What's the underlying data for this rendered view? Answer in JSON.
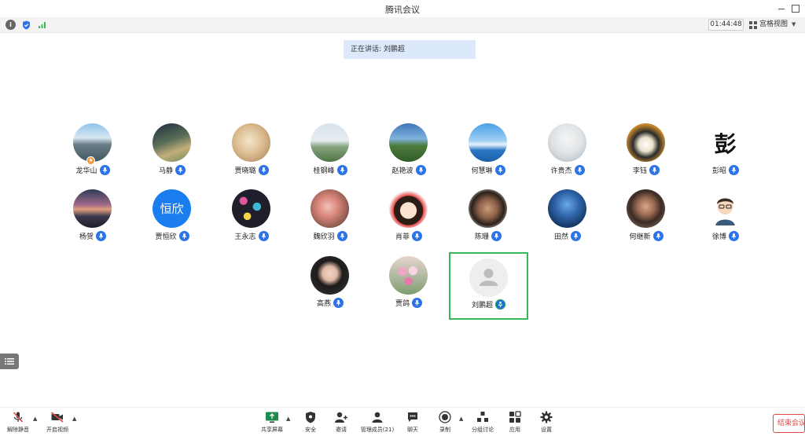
{
  "window": {
    "title": "腾讯会议"
  },
  "infobar": {
    "timer": "01:44:48",
    "view_mode": "宫格视图",
    "icons": [
      "info-icon",
      "shield-icon",
      "signal-icon"
    ]
  },
  "speaking": {
    "text": "正在讲话: 刘鹏超"
  },
  "participants": [
    {
      "name": "龙华山",
      "host": true
    },
    {
      "name": "马静"
    },
    {
      "name": "贾晓璐"
    },
    {
      "name": "桂钢峰"
    },
    {
      "name": "赵艳波"
    },
    {
      "name": "何慧琳"
    },
    {
      "name": "许贵杰"
    },
    {
      "name": "李钰"
    },
    {
      "name": "彭昭",
      "avatar_text": "彭"
    },
    {
      "name": "杨贺"
    },
    {
      "name": "贾恒欣",
      "avatar_text": "恒欣"
    },
    {
      "name": "王永志"
    },
    {
      "name": "魏欣羽"
    },
    {
      "name": "肖菲"
    },
    {
      "name": "陈珊"
    },
    {
      "name": "田然"
    },
    {
      "name": "何继新"
    },
    {
      "name": "徐博"
    },
    {
      "name": "高燕"
    },
    {
      "name": "贾鸽"
    },
    {
      "name": "刘鹏超",
      "selected": true,
      "speaking": true
    }
  ],
  "toolbar": {
    "unmute": "解除静音",
    "start_video": "开启视频",
    "share_screen": "共享屏幕",
    "security": "安全",
    "invite": "邀请",
    "manage_members": "管理成员(21)",
    "chat": "聊天",
    "record": "录制",
    "breakout": "分组讨论",
    "apps": "应用",
    "settings": "设置",
    "end_meeting": "结束会议"
  },
  "colors": {
    "accent": "#2b73e6",
    "selected_border": "#35b75a",
    "end_red": "#e04848",
    "banner_bg": "#dce9fb"
  }
}
